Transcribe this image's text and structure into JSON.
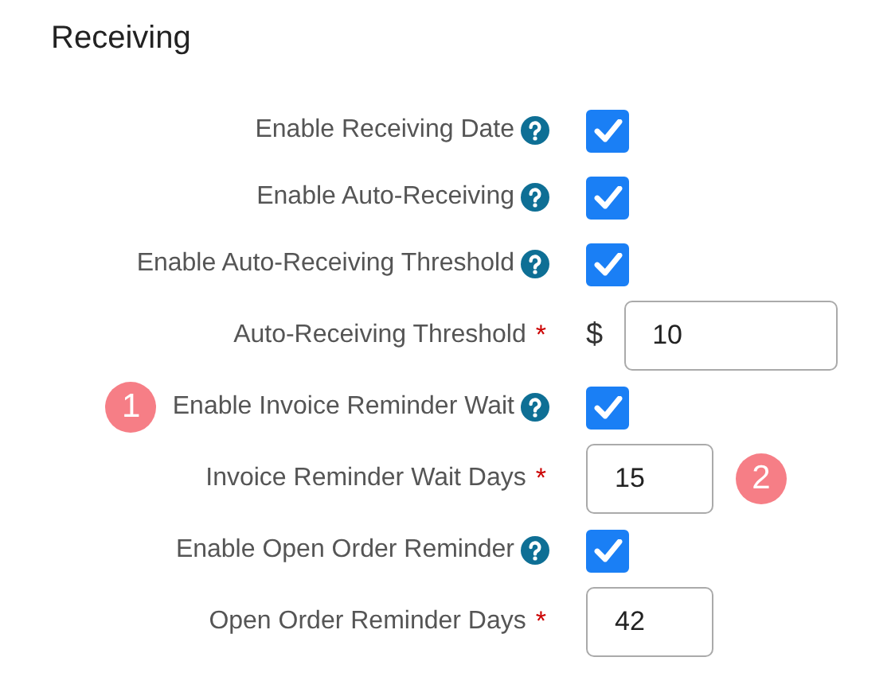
{
  "section": {
    "title": "Receiving"
  },
  "rows": [
    {
      "kind": "checkbox",
      "label": "Enable Receiving Date",
      "help": true,
      "checked": true
    },
    {
      "kind": "checkbox",
      "label": "Enable Auto-Receiving",
      "help": true,
      "checked": true
    },
    {
      "kind": "checkbox",
      "label": "Enable Auto-Receiving Threshold",
      "help": true,
      "checked": true
    },
    {
      "kind": "number",
      "label": "Auto-Receiving Threshold",
      "required_mark": "*",
      "prefix": "$",
      "value": "10",
      "wide": true
    },
    {
      "kind": "checkbox",
      "label": "Enable Invoice Reminder Wait",
      "help": true,
      "checked": true,
      "badge_before": "1"
    },
    {
      "kind": "number",
      "label": "Invoice Reminder Wait Days",
      "required_mark": "*",
      "value": "15",
      "wide": false,
      "badge_after": "2"
    },
    {
      "kind": "checkbox",
      "label": "Enable Open Order Reminder",
      "help": true,
      "checked": true
    },
    {
      "kind": "number",
      "label": "Open Order Reminder Days",
      "required_mark": "*",
      "value": "42",
      "wide": false
    }
  ]
}
